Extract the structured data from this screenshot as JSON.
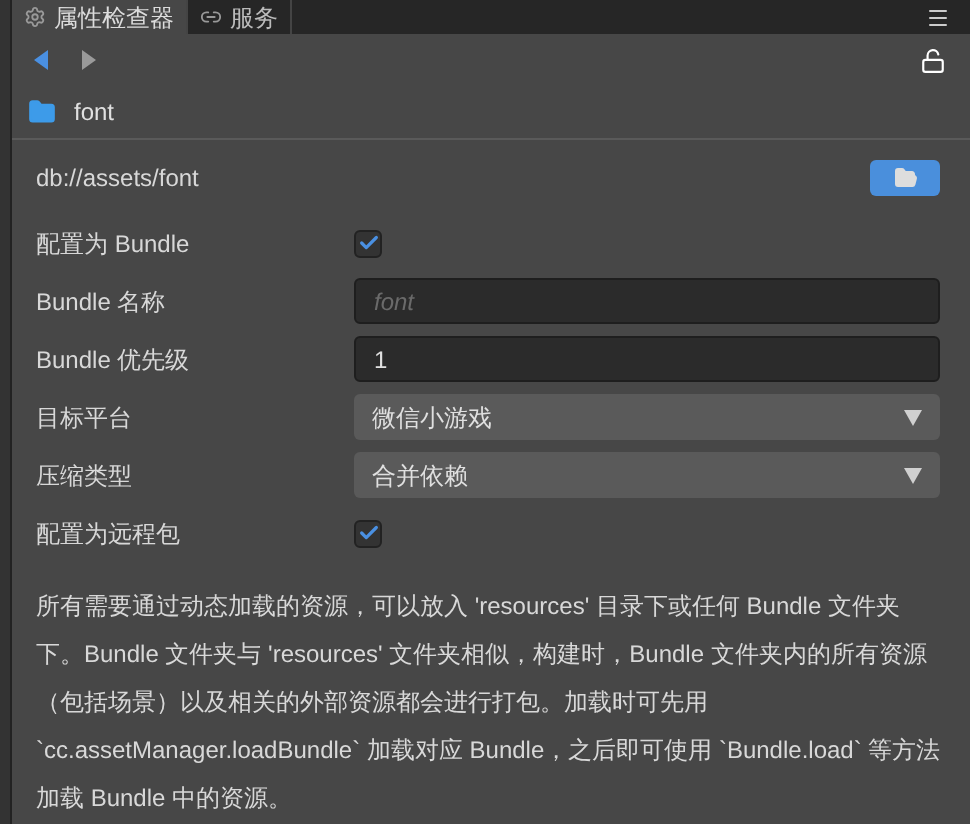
{
  "tabs": [
    {
      "label": "属性检查器",
      "kind": "settings",
      "selected": true
    },
    {
      "label": "服务",
      "kind": "service",
      "selected": false
    }
  ],
  "asset": {
    "name": "font",
    "path": "db://assets/font"
  },
  "fields": [
    {
      "kind": "checkbox",
      "label": "配置为 Bundle",
      "checked": true
    },
    {
      "kind": "input",
      "label": "Bundle 名称",
      "placeholder": "font"
    },
    {
      "kind": "input",
      "label": "Bundle 优先级",
      "value": "1"
    },
    {
      "kind": "select",
      "label": "目标平台",
      "value": "微信小游戏"
    },
    {
      "kind": "select",
      "label": "压缩类型",
      "value": "合并依赖"
    },
    {
      "kind": "checkbox",
      "label": "配置为远程包",
      "checked": true
    }
  ],
  "description": "所有需要通过动态加载的资源，可以放入 'resources' 目录下或任何 Bundle 文件夹下。Bundle 文件夹与 'resources' 文件夹相似，构建时，Bundle 文件夹内的所有资源（包括场景）以及相关的外部资源都会进行打包。加载时可先用 `cc.assetManager.loadBundle` 加载对应 Bundle，之后即可使用 `Bundle.load` 等方法加载 Bundle 中的资源。"
}
